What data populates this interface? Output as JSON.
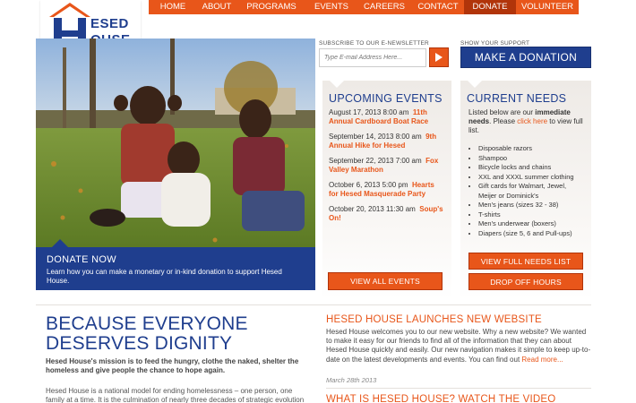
{
  "nav": {
    "items": [
      {
        "label": "HOME",
        "active": false
      },
      {
        "label": "ABOUT",
        "active": false
      },
      {
        "label": "PROGRAMS",
        "active": false
      },
      {
        "label": "EVENTS",
        "active": false
      },
      {
        "label": "CAREERS",
        "active": false
      },
      {
        "label": "CONTACT",
        "active": false
      },
      {
        "label": "DONATE",
        "active": true
      },
      {
        "label": "VOLUNTEER",
        "active": false
      }
    ]
  },
  "logo": {
    "word_top": "ESED",
    "word_bottom": "OUSE",
    "tagline": "BECAUSE EVERYONE DESERVES DIGNITY"
  },
  "newsletter": {
    "label": "Subscribe to our e-newsletter",
    "placeholder": "Type E-mail Address Here..."
  },
  "support": {
    "label": "Show your support",
    "button": "Make a Donation"
  },
  "donate_now": {
    "title": "Donate Now",
    "description": "Learn how you can make a monetary or in-kind donation to support Hesed House."
  },
  "events": {
    "heading": "Upcoming Events",
    "items": [
      {
        "date": "August 17, 2013 8:00 am",
        "title": "11th Annual Cardboard Boat Race"
      },
      {
        "date": "September 14, 2013 8:00 am",
        "title": "9th Annual Hike for Hesed"
      },
      {
        "date": "September 22, 2013 7:00 am",
        "title": "Fox Valley Marathon"
      },
      {
        "date": "October 6, 2013 5:00 pm",
        "title": "Hearts for Hesed Masquerade Party"
      },
      {
        "date": "October 20, 2013 11:30 am",
        "title": "Soup's On!"
      }
    ],
    "button": "View All Events"
  },
  "needs": {
    "heading": "Current Needs",
    "intro_1": "Listed below are our ",
    "intro_bold": "immediate needs",
    "intro_2": ". Please ",
    "intro_link": "click here",
    "intro_3": " to view full list.",
    "items": [
      "Disposable razors",
      "Shampoo",
      "Bicycle locks and chains",
      "XXL and XXXL summer clothing",
      "Gift cards for Walmart, Jewel, Meijer or Dominick's",
      "Men's jeans (sizes 32 - 38)",
      "T-shirts",
      "Men's underwear (boxers)",
      "Diapers (size 5, 6 and Pull-ups)"
    ],
    "button_full": "View Full Needs List",
    "button_dropoff": "Drop Off Hours"
  },
  "about": {
    "heading": "Because Everyone Deserves Dignity",
    "mission": "Hesed House's mission is to feed the hungry, clothe the naked, shelter the homeless and give people the chance to hope again.",
    "body": "Hesed House is a national model for ending homelessness – one person, one family at a time. It is the culmination of nearly three decades of strategic evolution"
  },
  "news": {
    "title_1": "Hesed House Launches New Website",
    "body": "Hesed House welcomes you to our new website.  Why a new website?  We wanted to make it easy for our friends to find all of the information that they can about Hesed House quickly and easily.  Our new navigation makes it simple to keep up-to-date on the latest developments and events. You can find out ",
    "read_more": "Read more...",
    "date": "March 28th 2013",
    "title_2": "What is Hesed House? Watch the video"
  },
  "colors": {
    "orange": "#e8561a",
    "blue": "#1f3e8e"
  }
}
